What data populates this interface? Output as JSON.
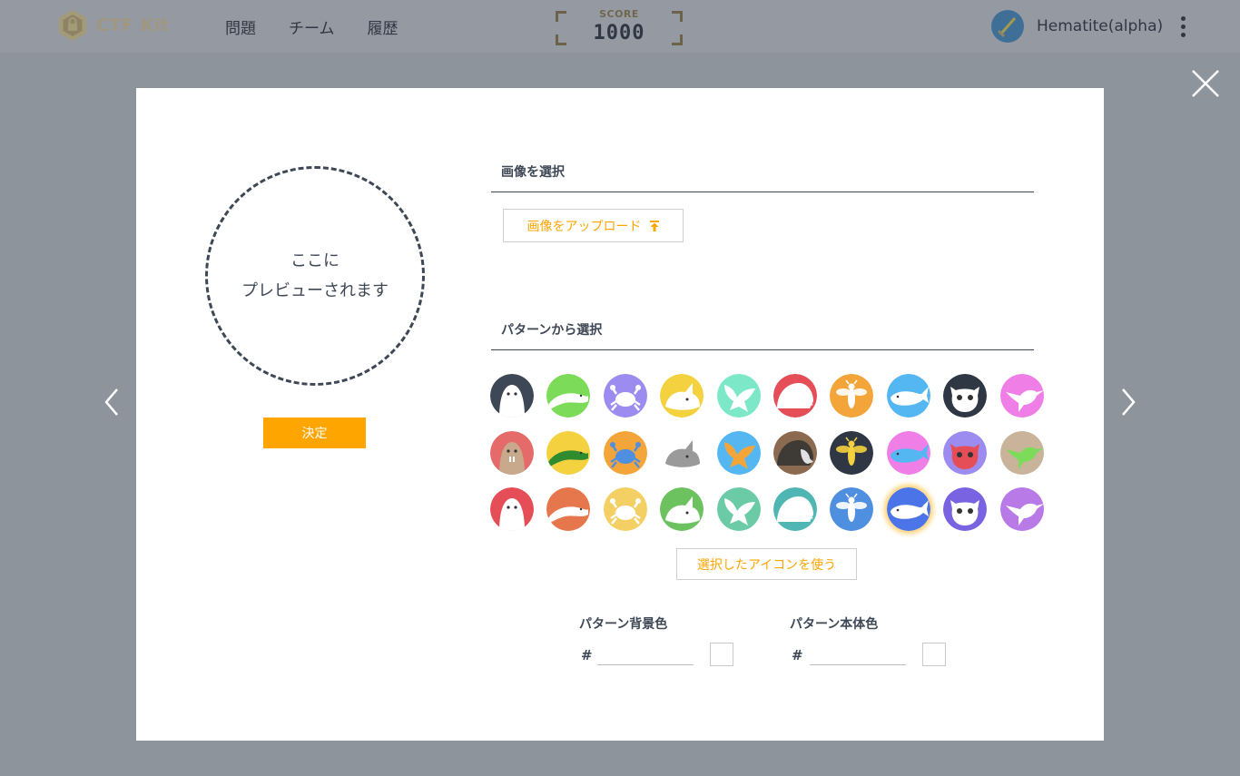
{
  "header": {
    "logo_text": "CTF Kit",
    "nav": [
      "問題",
      "チーム",
      "履歴"
    ],
    "score_label": "SCORE",
    "score_value": "1000",
    "user_name": "Hematite(alpha)"
  },
  "modal": {
    "preview_line1": "ここに",
    "preview_line2": "プレビューされます",
    "decide_label": "決定",
    "image_section_title": "画像を選択",
    "upload_label": "画像をアップロード",
    "pattern_section_title": "パターンから選択",
    "use_selected_label": "選択したアイコンを使う",
    "bg_color_label": "パターン背景色",
    "body_color_label": "パターン本体色",
    "hash": "#",
    "bg_color_value": "",
    "body_color_value": ""
  },
  "patterns": [
    {
      "animal": "walrus-icon",
      "bg": "#3e4755",
      "fg": "#ffffff"
    },
    {
      "animal": "snake-icon",
      "bg": "#7ddb5a",
      "fg": "#ffffff"
    },
    {
      "animal": "crab-icon",
      "bg": "#9c8cf0",
      "fg": "#ffffff"
    },
    {
      "animal": "rhino-icon",
      "bg": "#f4d23f",
      "fg": "#ffffff"
    },
    {
      "animal": "bird-icon",
      "bg": "#7de8c7",
      "fg": "#ffffff"
    },
    {
      "animal": "hedgehog-icon",
      "bg": "#e54e56",
      "fg": "#ffffff"
    },
    {
      "animal": "bee-icon",
      "bg": "#f4a53a",
      "fg": "#ffffff"
    },
    {
      "animal": "whale-icon",
      "bg": "#54b7f2",
      "fg": "#ffffff"
    },
    {
      "animal": "lemur-icon",
      "bg": "#2f3744",
      "fg": "#ffffff"
    },
    {
      "animal": "hummingbird-icon",
      "bg": "#ef7fe6",
      "fg": "#ffffff"
    },
    {
      "animal": "walrus-icon",
      "bg": "#e56a6a",
      "fg": "#c9a98c"
    },
    {
      "animal": "snake-icon",
      "bg": "#f4d23f",
      "fg": "#2e8b2e"
    },
    {
      "animal": "crab-icon",
      "bg": "#f4a53a",
      "fg": "#4f8fe0"
    },
    {
      "animal": "rhino-icon",
      "bg": "#ffffff",
      "fg": "#9a9a9a"
    },
    {
      "animal": "bird-icon",
      "bg": "#54b7f2",
      "fg": "#f4a53a"
    },
    {
      "animal": "hedgehog-icon",
      "bg": "#8b6a4f",
      "fg": "#3e3a36"
    },
    {
      "animal": "bee-icon",
      "bg": "#2f3744",
      "fg": "#f4d23f"
    },
    {
      "animal": "whale-icon",
      "bg": "#ef7fe6",
      "fg": "#54b7f2"
    },
    {
      "animal": "lemur-icon",
      "bg": "#9c8cf0",
      "fg": "#e54e56"
    },
    {
      "animal": "hummingbird-icon",
      "bg": "#c9b39a",
      "fg": "#7ddb5a"
    },
    {
      "animal": "walrus-icon",
      "bg": "#e54e56",
      "fg": "#ffffff"
    },
    {
      "animal": "snake-icon",
      "bg": "#e6774c",
      "fg": "#ffffff"
    },
    {
      "animal": "crab-icon",
      "bg": "#f4cf63",
      "fg": "#ffffff"
    },
    {
      "animal": "rhino-icon",
      "bg": "#6bc25f",
      "fg": "#ffffff"
    },
    {
      "animal": "bird-icon",
      "bg": "#6ccba7",
      "fg": "#ffffff"
    },
    {
      "animal": "hedgehog-icon",
      "bg": "#4fb6b3",
      "fg": "#ffffff"
    },
    {
      "animal": "bee-icon",
      "bg": "#4f8fe0",
      "fg": "#ffffff"
    },
    {
      "animal": "whale-icon",
      "bg": "#4a74e8",
      "fg": "#ffffff",
      "selected": true
    },
    {
      "animal": "lemur-icon",
      "bg": "#7a63e0",
      "fg": "#ffffff"
    },
    {
      "animal": "hummingbird-icon",
      "bg": "#b77ae6",
      "fg": "#ffffff"
    }
  ]
}
